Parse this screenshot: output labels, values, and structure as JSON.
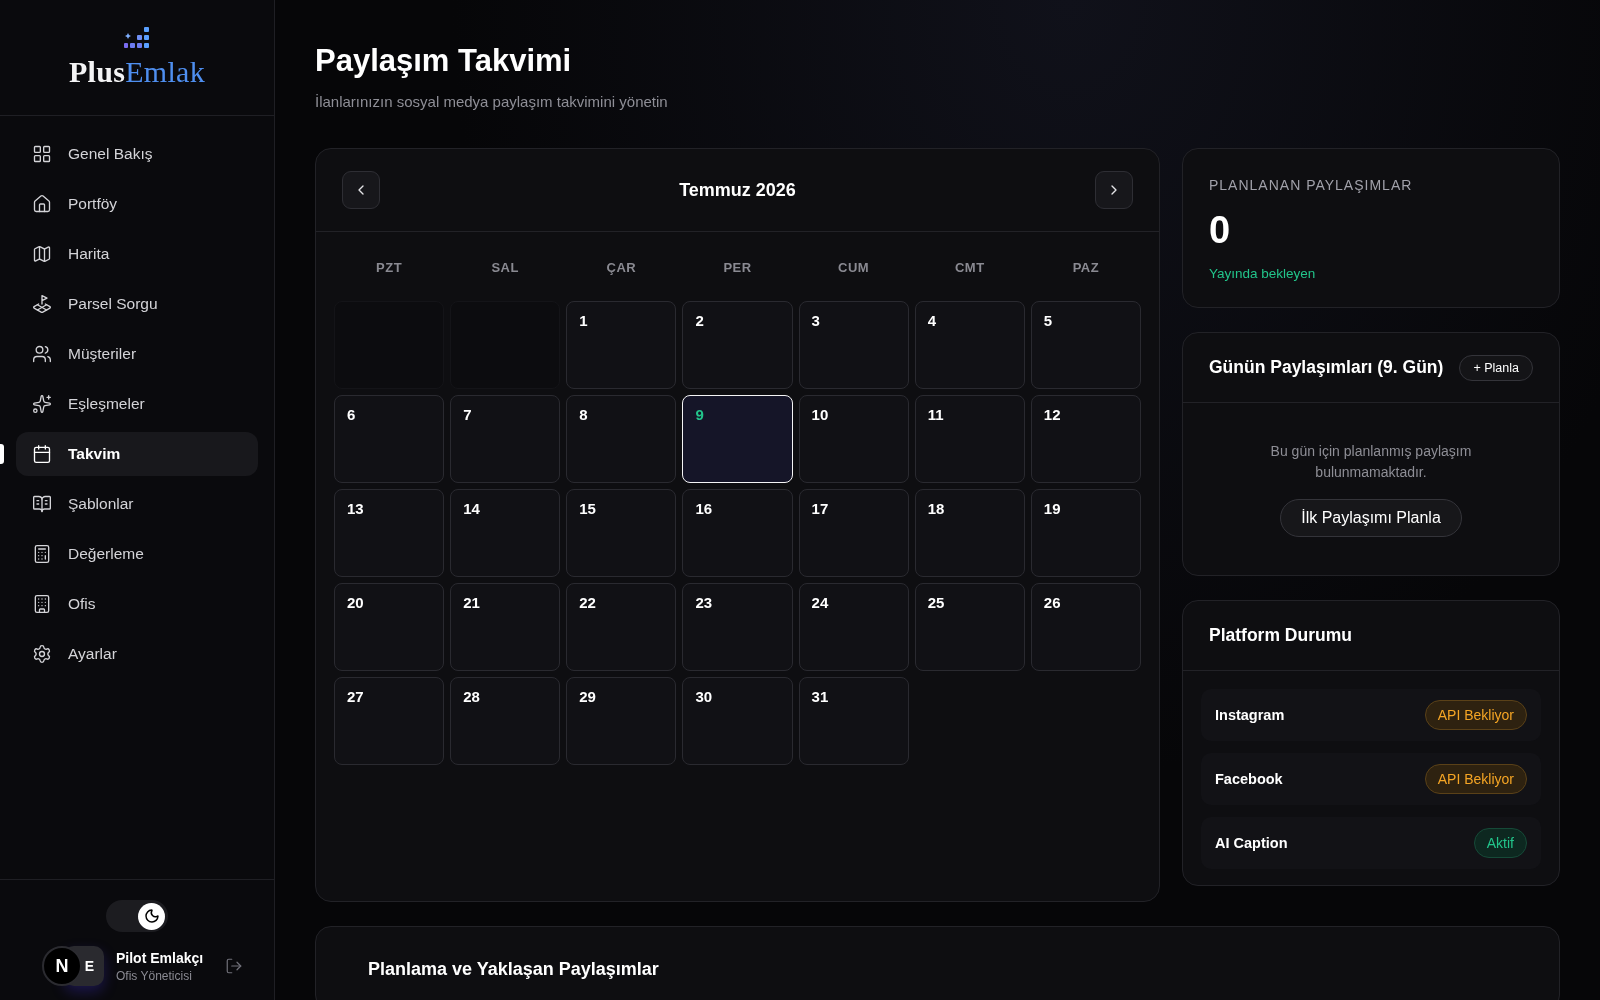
{
  "sidebar": {
    "logo": {
      "part1": "Plus",
      "part2": "Emlak"
    },
    "items": [
      {
        "label": "Genel Bakış",
        "selected": false
      },
      {
        "label": "Portföy",
        "selected": false
      },
      {
        "label": "Harita",
        "selected": false
      },
      {
        "label": "Parsel Sorgu",
        "selected": false
      },
      {
        "label": "Müşteriler",
        "selected": false
      },
      {
        "label": "Eşleşmeler",
        "selected": false
      },
      {
        "label": "Takvim",
        "selected": true
      },
      {
        "label": "Şablonlar",
        "selected": false
      },
      {
        "label": "Değerleme",
        "selected": false
      },
      {
        "label": "Ofis",
        "selected": false
      },
      {
        "label": "Ayarlar",
        "selected": false
      }
    ],
    "theme_toggle": {
      "on": true
    },
    "dev_badge": "N",
    "user": {
      "initials": "E",
      "name": "Pilot Emlakçı",
      "role": "Ofis Yöneticisi"
    }
  },
  "page": {
    "title": "Paylaşım Takvimi",
    "subtitle": "İlanlarınızın sosyal medya paylaşım takvimini yönetin"
  },
  "calendar": {
    "month": "Temmuz 2026",
    "weekdays": [
      "PZT",
      "SAL",
      "ÇAR",
      "PER",
      "CUM",
      "CMT",
      "PAZ"
    ],
    "days": [
      {
        "kind": "blank"
      },
      {
        "kind": "blank"
      },
      {
        "kind": "day",
        "label": "1",
        "selected": false
      },
      {
        "kind": "day",
        "label": "2",
        "selected": false
      },
      {
        "kind": "day",
        "label": "3",
        "selected": false
      },
      {
        "kind": "day",
        "label": "4",
        "selected": false
      },
      {
        "kind": "day",
        "label": "5",
        "selected": false
      },
      {
        "kind": "day",
        "label": "6",
        "selected": false
      },
      {
        "kind": "day",
        "label": "7",
        "selected": false
      },
      {
        "kind": "day",
        "label": "8",
        "selected": false
      },
      {
        "kind": "day",
        "label": "9",
        "selected": true
      },
      {
        "kind": "day",
        "label": "10",
        "selected": false
      },
      {
        "kind": "day",
        "label": "11",
        "selected": false
      },
      {
        "kind": "day",
        "label": "12",
        "selected": false
      },
      {
        "kind": "day",
        "label": "13",
        "selected": false
      },
      {
        "kind": "day",
        "label": "14",
        "selected": false
      },
      {
        "kind": "day",
        "label": "15",
        "selected": false
      },
      {
        "kind": "day",
        "label": "16",
        "selected": false
      },
      {
        "kind": "day",
        "label": "17",
        "selected": false
      },
      {
        "kind": "day",
        "label": "18",
        "selected": false
      },
      {
        "kind": "day",
        "label": "19",
        "selected": false
      },
      {
        "kind": "day",
        "label": "20",
        "selected": false
      },
      {
        "kind": "day",
        "label": "21",
        "selected": false
      },
      {
        "kind": "day",
        "label": "22",
        "selected": false
      },
      {
        "kind": "day",
        "label": "23",
        "selected": false
      },
      {
        "kind": "day",
        "label": "24",
        "selected": false
      },
      {
        "kind": "day",
        "label": "25",
        "selected": false
      },
      {
        "kind": "day",
        "label": "26",
        "selected": false
      },
      {
        "kind": "day",
        "label": "27",
        "selected": false
      },
      {
        "kind": "day",
        "label": "28",
        "selected": false
      },
      {
        "kind": "day",
        "label": "29",
        "selected": false
      },
      {
        "kind": "day",
        "label": "30",
        "selected": false
      },
      {
        "kind": "day",
        "label": "31",
        "selected": false
      }
    ]
  },
  "stats": {
    "label": "PLANLANAN PAYLAŞIMLAR",
    "value": "0",
    "note": "Yayında bekleyen"
  },
  "day_posts": {
    "title": "Günün Paylaşımları (9. Gün)",
    "add_button": "+ Planla",
    "empty_text": "Bu gün için planlanmış paylaşım bulunmamaktadır.",
    "cta_button": "İlk Paylaşımı Planla"
  },
  "platforms": {
    "title": "Platform Durumu",
    "items": [
      {
        "name": "Instagram",
        "status": "API Bekliyor",
        "kind": "pending"
      },
      {
        "name": "Facebook",
        "status": "API Bekliyor",
        "kind": "pending"
      },
      {
        "name": "AI Caption",
        "status": "Aktif",
        "kind": "active"
      }
    ]
  },
  "upcoming": {
    "title": "Planlama ve Yaklaşan Paylaşımlar"
  }
}
